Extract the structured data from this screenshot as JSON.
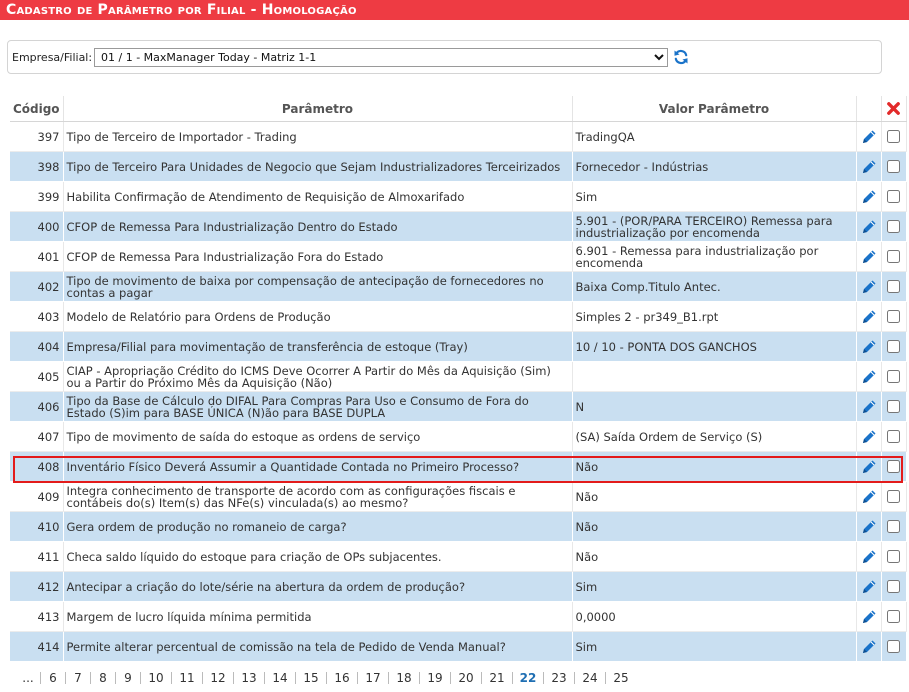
{
  "page": {
    "title": "Cadastro de Parâmetro por Filial - Homologação"
  },
  "filter": {
    "label": "Empresa/Filial:",
    "selected": "01 / 1 - MaxManager Today - Matriz 1-1"
  },
  "table": {
    "headers": {
      "code": "Código",
      "param": "Parâmetro",
      "value": "Valor Parâmetro"
    },
    "rows": [
      {
        "code": "397",
        "param": "Tipo de Terceiro de Importador - Trading",
        "value": "TradingQA"
      },
      {
        "code": "398",
        "param": "Tipo de Terceiro Para Unidades de Negocio que Sejam Industrializadores Terceirizados",
        "value": "Fornecedor - Indústrias"
      },
      {
        "code": "399",
        "param": "Habilita Confirmação de Atendimento de Requisição de Almoxarifado",
        "value": "Sim"
      },
      {
        "code": "400",
        "param": "CFOP de Remessa Para Industrialização Dentro do Estado",
        "value": "5.901 - (POR/PARA TERCEIRO) Remessa para industrialização por encomenda"
      },
      {
        "code": "401",
        "param": "CFOP de Remessa Para Industrialização Fora do Estado",
        "value": "6.901 - Remessa para industrialização por encomenda"
      },
      {
        "code": "402",
        "param": "Tipo de movimento de baixa por compensação de antecipação de fornecedores no contas a pagar",
        "value": "Baixa Comp.Titulo Antec."
      },
      {
        "code": "403",
        "param": "Modelo de Relatório para Ordens de Produção",
        "value": "Simples 2 - pr349_B1.rpt"
      },
      {
        "code": "404",
        "param": "Empresa/Filial para movimentação de transferência de estoque (Tray)",
        "value": "10 / 10 - PONTA DOS GANCHOS"
      },
      {
        "code": "405",
        "param": "CIAP - Apropriação Crédito do ICMS Deve Ocorrer A Partir do Mês da Aquisição (Sim) ou a Partir do Próximo Mês da Aquisição (Não)",
        "value": ""
      },
      {
        "code": "406",
        "param": "Tipo da Base de Cálculo do DIFAL Para Compras Para Uso e Consumo de Fora do Estado (S)im para BASE ÚNICA (N)ão para BASE DUPLA",
        "value": "N"
      },
      {
        "code": "407",
        "param": "Tipo de movimento de saída do estoque as ordens de serviço",
        "value": "(SA) Saída Ordem de Serviço (S)"
      },
      {
        "code": "408",
        "param": "Inventário Físico Deverá Assumir a Quantidade Contada no Primeiro Processo?",
        "value": "Não"
      },
      {
        "code": "409",
        "param": "Integra conhecimento de transporte de acordo com as configurações fiscais e contábeis do(s) Item(s) das NFe(s) vinculada(s) ao mesmo?",
        "value": "Não"
      },
      {
        "code": "410",
        "param": "Gera ordem de produção no romaneio de carga?",
        "value": "Não"
      },
      {
        "code": "411",
        "param": "Checa saldo líquido do estoque para criação de OPs subjacentes.",
        "value": "Não"
      },
      {
        "code": "412",
        "param": "Antecipar a criação do lote/série na abertura da ordem de produção?",
        "value": "Sim"
      },
      {
        "code": "413",
        "param": "Margem de lucro líquida mínima permitida",
        "value": "0,0000"
      },
      {
        "code": "414",
        "param": "Permite alterar percentual de comissão na tela de Pedido de Venda Manual?",
        "value": "Sim"
      }
    ]
  },
  "pager": {
    "ellipsis": "...",
    "pages": [
      "6",
      "7",
      "8",
      "9",
      "10",
      "11",
      "12",
      "13",
      "14",
      "15",
      "16",
      "17",
      "18",
      "19",
      "20",
      "21",
      "22",
      "23",
      "24",
      "25"
    ],
    "current": "22"
  },
  "colors": {
    "title_bg": "#ee3b43",
    "row_alt": "#c9dff1",
    "icon_blue": "#1a73c9",
    "highlight": "#e31b1b"
  }
}
